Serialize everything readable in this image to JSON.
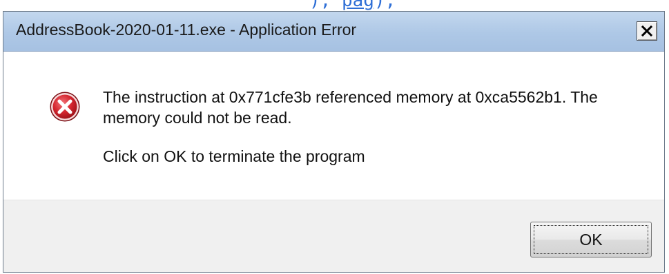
{
  "top_strip": {
    "fragment_a": "),",
    "fragment_b": "pag",
    "fragment_c": ");"
  },
  "dialog": {
    "title": "AddressBook-2020-01-11.exe - Application Error",
    "close_glyph": "✕",
    "icon": "error-icon",
    "message_line1": "The instruction at 0x771cfe3b referenced memory at 0xca5562b1. The memory could not be read.",
    "message_line2": "Click on OK to terminate the program",
    "ok_label": "OK"
  },
  "colors": {
    "titlebar": "#aec8e6",
    "error_red": "#c9202a",
    "footer": "#f0f0f0",
    "link_blue": "#2f6fd6"
  }
}
